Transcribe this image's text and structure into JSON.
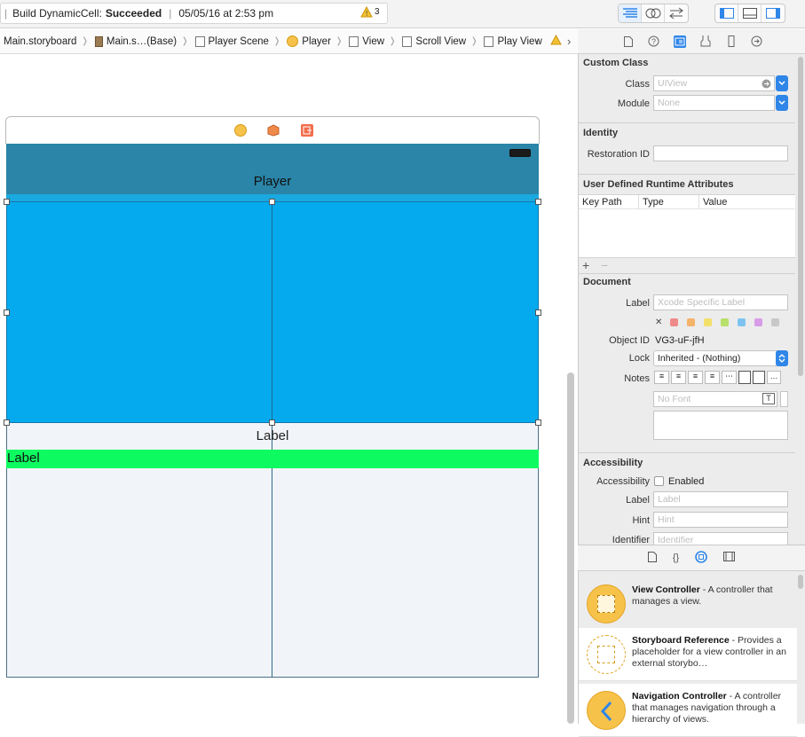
{
  "toolbar": {
    "status_prefix": "Build DynamicCell:",
    "status_result": "Succeeded",
    "status_time": "05/05/16 at 2:53 pm",
    "warning_count": "3"
  },
  "jumpbar": {
    "crumbs": [
      "Main.storyboard",
      "Main.s…(Base)",
      "Player Scene",
      "Player",
      "View",
      "Scroll View",
      "Play View"
    ]
  },
  "canvas": {
    "nav_title": "Player",
    "center_label": "Label",
    "green_label": "Label"
  },
  "inspector": {
    "custom_class": {
      "title": "Custom Class",
      "class_label": "Class",
      "class_placeholder": "UIView",
      "module_label": "Module",
      "module_placeholder": "None"
    },
    "identity": {
      "title": "Identity",
      "restoration_label": "Restoration ID"
    },
    "runtime_attrs": {
      "title": "User Defined Runtime Attributes",
      "columns": [
        "Key Path",
        "Type",
        "Value"
      ],
      "add": "+",
      "remove": "−"
    },
    "document": {
      "title": "Document",
      "label_label": "Label",
      "label_placeholder": "Xcode Specific Label",
      "object_id_label": "Object ID",
      "object_id_value": "VG3-uF-jfH",
      "lock_label": "Lock",
      "lock_value": "Inherited - (Nothing)",
      "notes_label": "Notes",
      "font_placeholder": "No Font",
      "color_swatches": [
        "#f08a8a",
        "#f5b36a",
        "#f3e06a",
        "#b8e06a",
        "#7ec3f0",
        "#d79be8",
        "#c8c8c8"
      ]
    },
    "accessibility": {
      "title": "Accessibility",
      "accessibility_label": "Accessibility",
      "enabled_label": "Enabled",
      "label_label": "Label",
      "label_placeholder": "Label",
      "hint_label": "Hint",
      "hint_placeholder": "Hint",
      "identifier_label": "Identifier",
      "identifier_placeholder": "Identifier"
    }
  },
  "library": {
    "items": [
      {
        "title": "View Controller",
        "desc": " - A controller that manages a view."
      },
      {
        "title": "Storyboard Reference",
        "desc": " - Provides a placeholder for a view controller in an external storybo…"
      },
      {
        "title": "Navigation Controller",
        "desc": " - A controller that manages navigation through a hierarchy of views."
      }
    ]
  },
  "colors": {
    "nav_bar": "#2a85a8",
    "selected_view": "#05aaee",
    "green_label": "#0dfb61",
    "accent": "#2f86e8"
  }
}
